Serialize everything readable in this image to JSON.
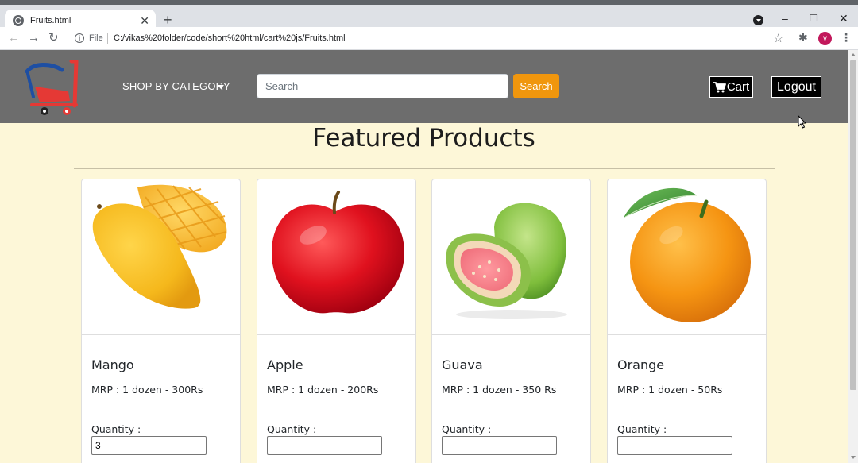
{
  "browser": {
    "tab_title": "Fruits.html",
    "file_label": "File",
    "url": "C:/vikas%20folder/code/short%20html/cart%20js/Fruits.html",
    "profile_initial": "v"
  },
  "nav": {
    "category_label": "SHOP BY CATEGORY",
    "search_placeholder": "Search",
    "search_button": "Search",
    "cart_label": "Cart",
    "logout_label": "Logout"
  },
  "main": {
    "title": "Featured Products",
    "qty_label": "Quantity :",
    "products": [
      {
        "name": "Mango",
        "mrp": "MRP : 1 dozen - 300Rs",
        "quantity": "3"
      },
      {
        "name": "Apple",
        "mrp": "MRP : 1 dozen - 200Rs",
        "quantity": ""
      },
      {
        "name": "Guava",
        "mrp": "MRP : 1 dozen - 350 Rs",
        "quantity": ""
      },
      {
        "name": "Orange",
        "mrp": "MRP : 1 dozen - 50Rs",
        "quantity": ""
      }
    ]
  },
  "colors": {
    "page_bg": "#fdf7d8",
    "nav_bg": "#6d6d6d",
    "search_button": "#f0960d",
    "logo_red": "#e53935",
    "logo_blue": "#1e4fa3"
  }
}
